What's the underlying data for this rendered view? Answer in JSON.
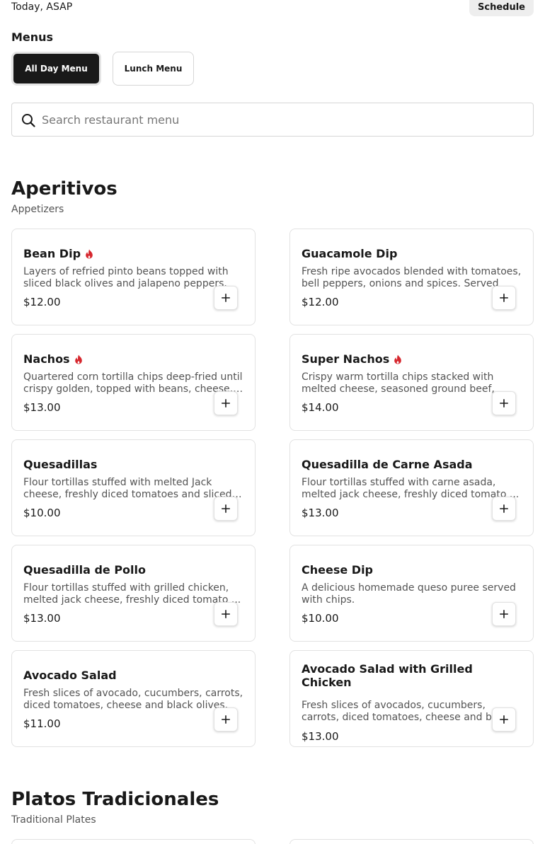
{
  "header": {
    "delivery_time": "Today, ASAP",
    "schedule_label": "Schedule"
  },
  "menus": {
    "heading": "Menus",
    "tabs": [
      {
        "label": "All Day Menu",
        "active": true
      },
      {
        "label": "Lunch Menu",
        "active": false
      }
    ]
  },
  "search": {
    "placeholder": "Search restaurant menu",
    "value": ""
  },
  "colors": {
    "spicy": "#d6272e",
    "active_tab": "#191919"
  },
  "sections": [
    {
      "title": "Aperitivos",
      "subtitle": "Appetizers",
      "items": [
        {
          "name": "Bean Dip",
          "spicy": true,
          "description": "Layers of refried pinto beans topped with sliced black olives and jalapeno peppers.",
          "price": "$12.00"
        },
        {
          "name": "Guacamole Dip",
          "spicy": false,
          "description": "Fresh ripe avocados blended with tomatoes, bell peppers, onions and spices. Served",
          "price": "$12.00"
        },
        {
          "name": "Nachos",
          "spicy": true,
          "description": "Quartered corn tortilla chips deep-fried until crispy golden, topped with beans, cheese, ...",
          "price": "$13.00"
        },
        {
          "name": "Super Nachos",
          "spicy": true,
          "description": "Crispy warm tortilla chips stacked with melted cheese, seasoned ground beef,",
          "price": "$14.00"
        },
        {
          "name": "Quesadillas",
          "spicy": false,
          "description": "Flour tortillas stuffed with melted Jack cheese, freshly diced tomatoes and sliced ...",
          "price": "$10.00"
        },
        {
          "name": "Quesadilla de Carne Asada",
          "spicy": false,
          "description": "Flour tortillas stuffed with carne asada, melted jack cheese, freshly diced tomato ...",
          "price": "$13.00"
        },
        {
          "name": "Quesadilla de Pollo",
          "spicy": false,
          "description": "Flour tortillas stuffed with grilled chicken, melted jack cheese, freshly diced tomato ...",
          "price": "$13.00"
        },
        {
          "name": "Cheese Dip",
          "spicy": false,
          "description": "A delicious homemade queso puree served with chips.",
          "price": "$10.00"
        },
        {
          "name": "Avocado Salad",
          "spicy": false,
          "description": "Fresh slices of avocado, cucumbers, carrots, diced tomatoes, cheese and black olives.",
          "price": "$11.00"
        },
        {
          "name": "Avocado Salad with Grilled Chicken",
          "spicy": false,
          "description": "Fresh slices of avocados, cucumbers, carrots, diced tomatoes, cheese and b...",
          "price": "$13.00"
        }
      ]
    },
    {
      "title": "Platos Tradicionales",
      "subtitle": "Traditional Plates",
      "items": []
    }
  ]
}
